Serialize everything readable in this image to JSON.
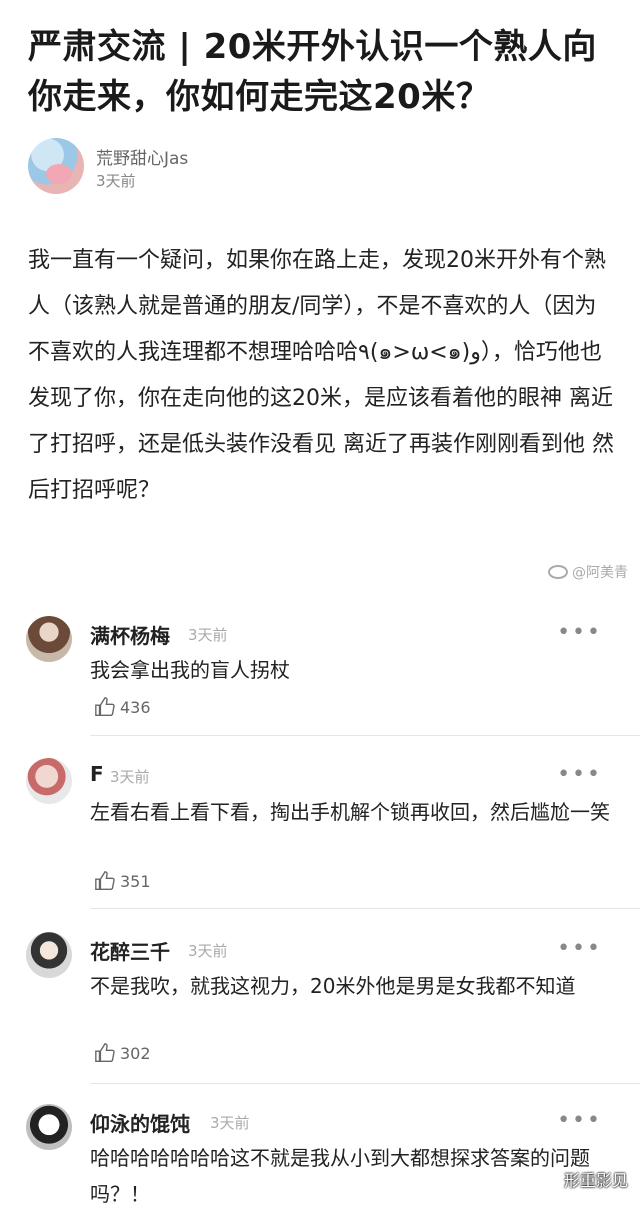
{
  "post": {
    "title": "严肃交流 | 20米开外认识一个熟人向你走来，你如何走完这20米？",
    "author_name": "荒野甜心Jas",
    "time": "3天前",
    "body": "我一直有一个疑问，如果你在路上走，发现20米开外有个熟人（该熟人就是普通的朋友/同学），不是不喜欢的人（因为不喜欢的人我连理都不想理哈哈哈٩(๑>ω<๑)و），恰巧他也发现了你，你在走向他的这20米，是应该看着他的眼神 离近了打招呼，还是低头装作没看见 离近了再装作刚刚看到他 然后打招呼呢？",
    "watermark": "@阿美青"
  },
  "comments": [
    {
      "name": "满杯杨梅",
      "time": "3天前",
      "text": "我会拿出我的盲人拐杖",
      "likes": "436"
    },
    {
      "name": "F",
      "time": "3天前",
      "text": "左看右看上看下看，掏出手机解个锁再收回，然后尴尬一笑",
      "likes": "351"
    },
    {
      "name": "花醉三千",
      "time": "3天前",
      "text": "不是我吹，就我这视力，20米外他是男是女我都不知道",
      "likes": "302"
    },
    {
      "name": "仰泳的馄饨",
      "time": "3天前",
      "text": "哈哈哈哈哈哈哈这不就是我从小到大都想探求答案的问题吗？！"
    }
  ],
  "ui": {
    "more": "•••",
    "corner_mark": "形重影见"
  },
  "icons": {
    "like": "thumbs-up-icon",
    "more": "more-dots-icon",
    "weibo": "weibo-icon"
  }
}
